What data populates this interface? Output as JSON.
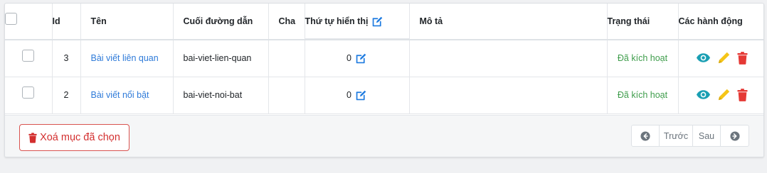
{
  "table": {
    "headers": {
      "id": "Id",
      "name": "Tên",
      "slug": "Cuối đường dẫn",
      "parent": "Cha",
      "order": "Thứ tự hiển thị",
      "description": "Mô tả",
      "status": "Trạng thái",
      "actions": "Các hành động"
    },
    "rows": [
      {
        "id": "3",
        "name": "Bài viết liên quan",
        "slug": "bai-viet-lien-quan",
        "parent": "",
        "order": "0",
        "description": "",
        "status": "Đã kích hoạt"
      },
      {
        "id": "2",
        "name": "Bài viết nổi bật",
        "slug": "bai-viet-noi-bat",
        "parent": "",
        "order": "0",
        "description": "",
        "status": "Đã kích hoạt"
      }
    ]
  },
  "footer": {
    "delete_selected_label": "Xoá mục đã chọn",
    "pagination": {
      "prev_label": "Trước",
      "next_label": "Sau"
    }
  },
  "icons": {
    "edit": "edit-icon",
    "view": "eye-icon",
    "pencil": "pencil-icon",
    "delete": "trash-icon",
    "prev": "arrow-left-circle-icon",
    "next": "arrow-right-circle-icon"
  },
  "colors": {
    "link": "#2f7bd9",
    "status_active": "#3f9d4c",
    "view_icon": "#1a9fb3",
    "edit_icon": "#f5c518",
    "delete_icon": "#e53935",
    "order_edit_icon": "#1e7be0",
    "danger_button": "#d32f2f"
  }
}
